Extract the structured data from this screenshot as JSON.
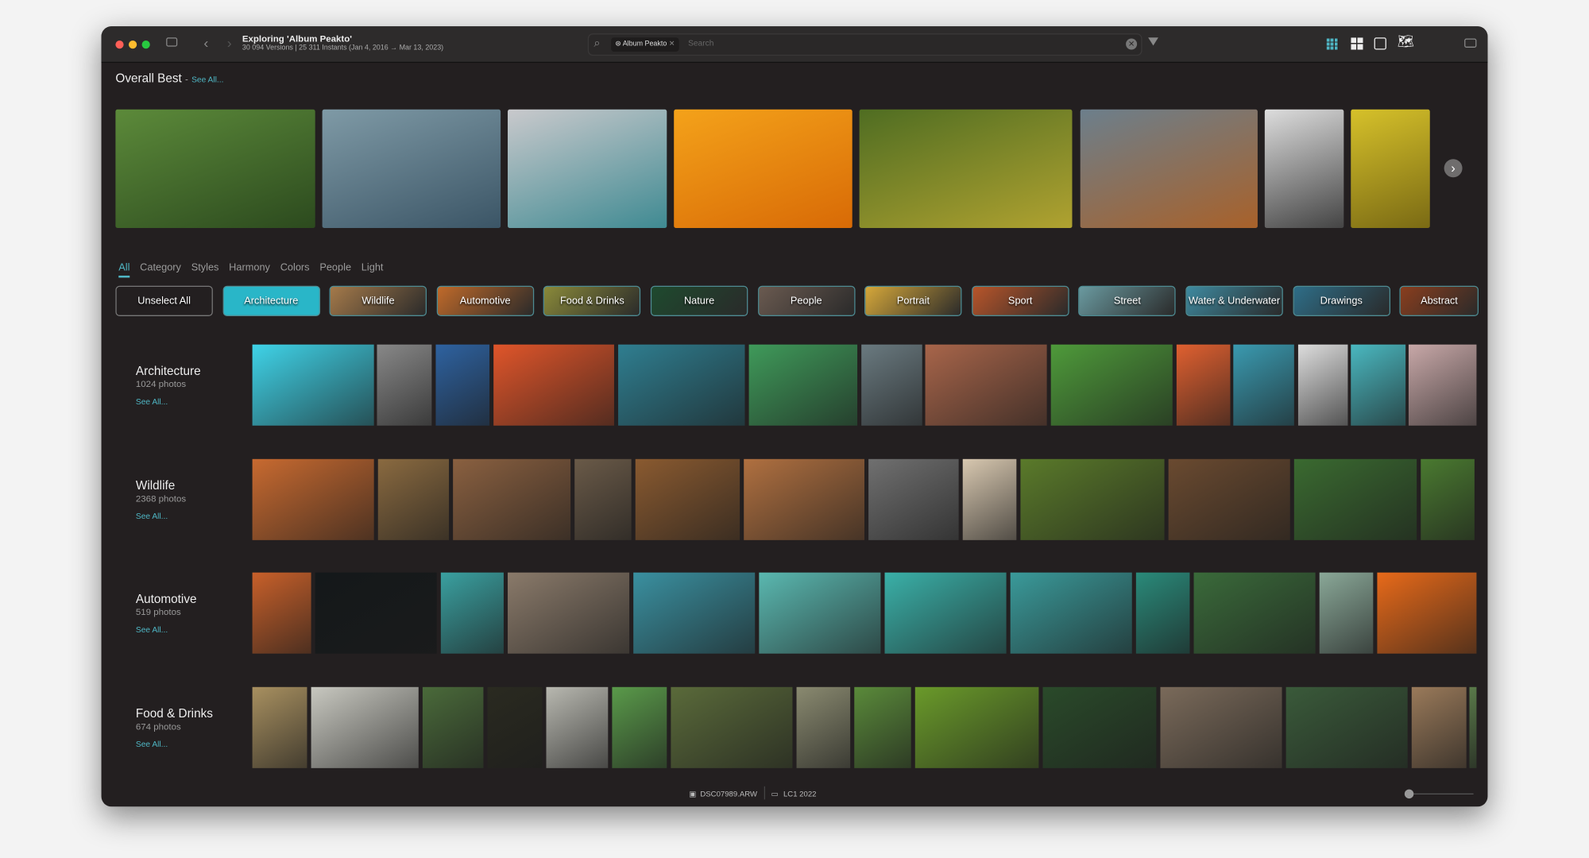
{
  "window": {
    "title": "Exploring 'Album Peakto'",
    "subtitle": "30 094 Versions | 25 311 Instants (Jan 4, 2016 → Mar 13, 2023)",
    "search": {
      "token": "Album Peakto",
      "placeholder": "Search"
    },
    "view_modes": [
      "grid-small",
      "grid-large",
      "single",
      "map"
    ],
    "active_view": "grid-small",
    "accent": "#4fb6c4"
  },
  "overall": {
    "title": "Overall Best",
    "separator": "-",
    "see_all": "See All..."
  },
  "tabs": [
    "All",
    "Category",
    "Styles",
    "Harmony",
    "Colors",
    "People",
    "Light"
  ],
  "active_tab": "All",
  "chips": [
    "Unselect All",
    "Architecture",
    "Wildlife",
    "Automotive",
    "Food & Drinks",
    "Nature",
    "People",
    "Portrait",
    "Sport",
    "Street",
    "Water & Underwater",
    "Drawings",
    "Abstract"
  ],
  "selected_chip": "Architecture",
  "sections": [
    {
      "name": "Architecture",
      "count": "1024 photos",
      "see_all": "See All..."
    },
    {
      "name": "Wildlife",
      "count": "2368 photos",
      "see_all": "See All..."
    },
    {
      "name": "Automotive",
      "count": "519 photos",
      "see_all": "See All..."
    },
    {
      "name": "Food & Drinks",
      "count": "674 photos",
      "see_all": "See All..."
    }
  ],
  "footer": {
    "file": "DSC07989.ARW",
    "folder": "LC1 2022"
  },
  "zoom_slider": 0
}
